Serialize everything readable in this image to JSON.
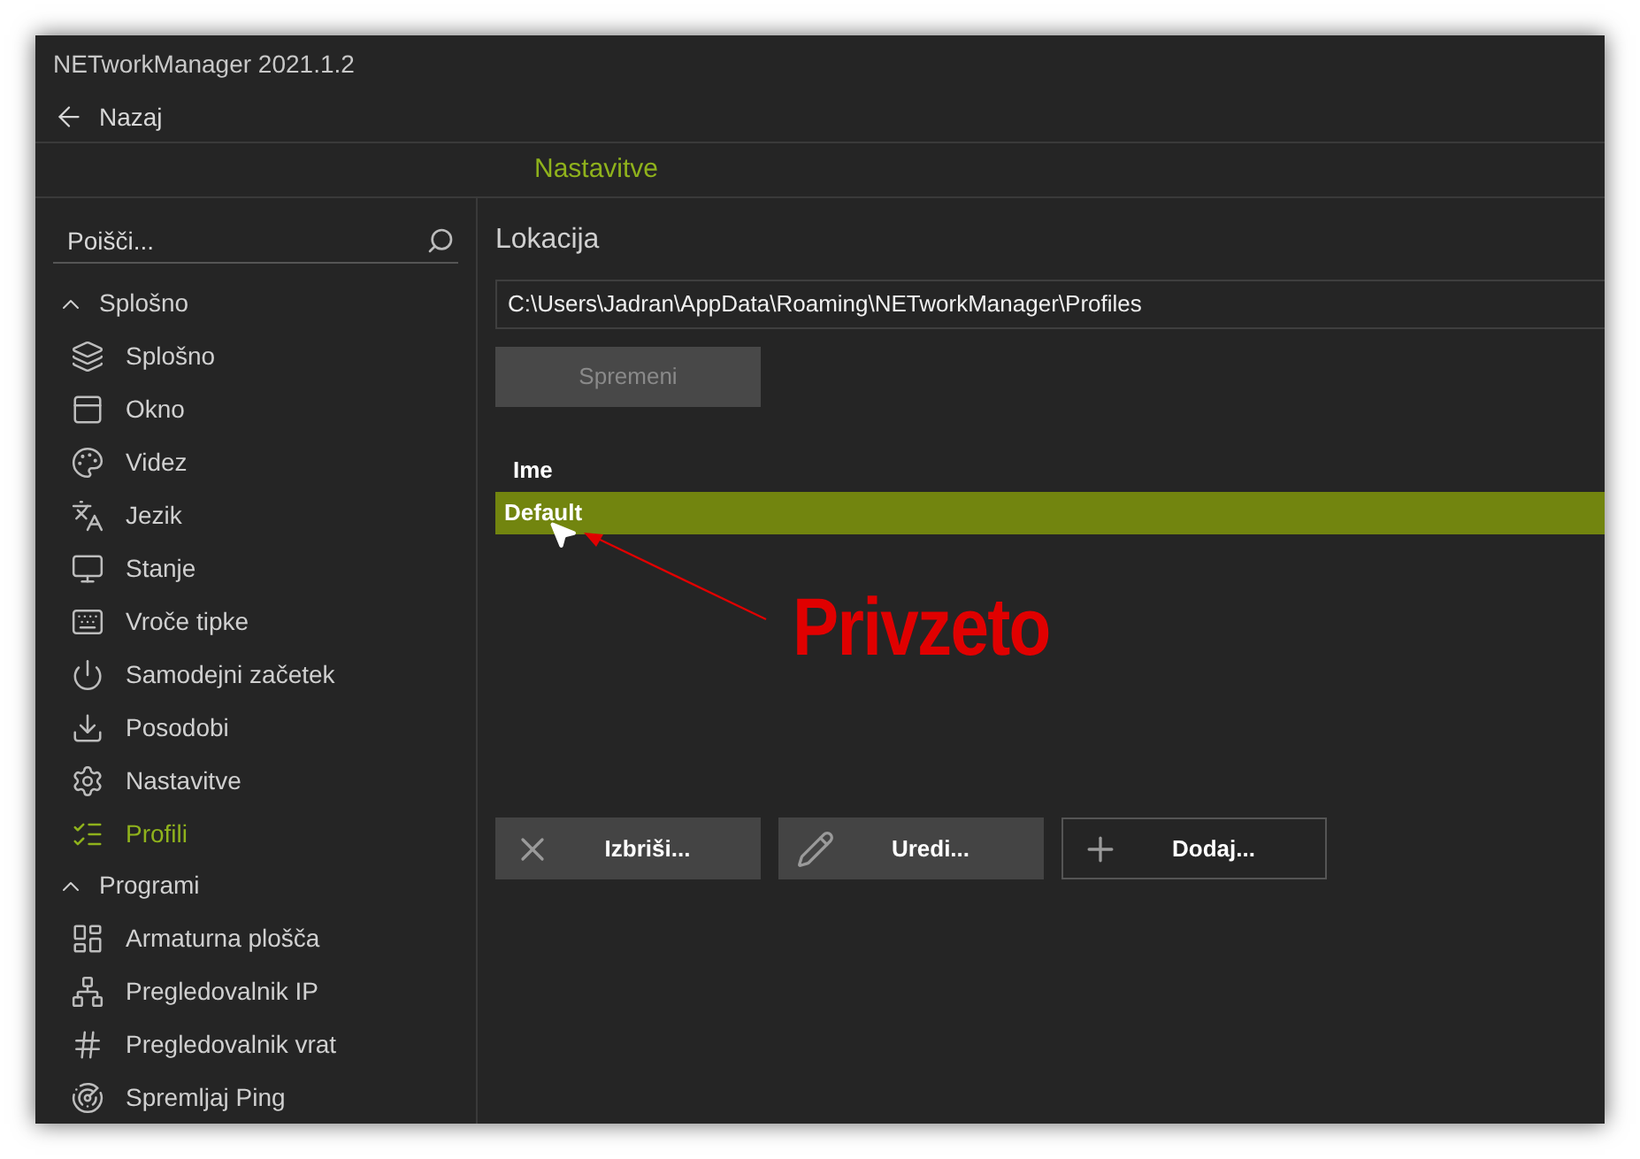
{
  "window": {
    "title": "NETworkManager 2021.1.2"
  },
  "back": {
    "label": "Nazaj"
  },
  "header": {
    "title": "Nastavitve"
  },
  "search": {
    "placeholder": "Poišči..."
  },
  "sidebar": {
    "groups": [
      {
        "label": "Splošno",
        "expanded": true,
        "children": [
          {
            "label": "Splošno",
            "selected": false
          },
          {
            "label": "Okno",
            "selected": false
          },
          {
            "label": "Videz",
            "selected": false
          },
          {
            "label": "Jezik",
            "selected": false
          },
          {
            "label": "Stanje",
            "selected": false
          },
          {
            "label": "Vroče tipke",
            "selected": false
          },
          {
            "label": "Samodejni začetek",
            "selected": false
          },
          {
            "label": "Posodobi",
            "selected": false
          },
          {
            "label": "Nastavitve",
            "selected": false
          },
          {
            "label": "Profili",
            "selected": true
          }
        ]
      },
      {
        "label": "Programi",
        "expanded": true,
        "children": [
          {
            "label": "Armaturna plošča",
            "selected": false
          },
          {
            "label": "Pregledovalnik IP",
            "selected": false
          },
          {
            "label": "Pregledovalnik vrat",
            "selected": false
          },
          {
            "label": "Spremljaj Ping",
            "selected": false
          }
        ]
      }
    ]
  },
  "location": {
    "label": "Lokacija",
    "value": "C:\\Users\\Jadran\\AppData\\Roaming\\NETworkManager\\Profiles",
    "button": {
      "label": "Spremeni",
      "disabled": true
    }
  },
  "table": {
    "columns": [
      "Ime"
    ],
    "rows": [
      {
        "cells": [
          "Default"
        ],
        "selected": true
      }
    ]
  },
  "buttons": [
    {
      "label": "Izbriši...",
      "focused": false
    },
    {
      "label": "Uredi...",
      "focused": false
    },
    {
      "label": "Dodaj...",
      "focused": true
    }
  ],
  "annotation": {
    "text": "Privzeto"
  }
}
